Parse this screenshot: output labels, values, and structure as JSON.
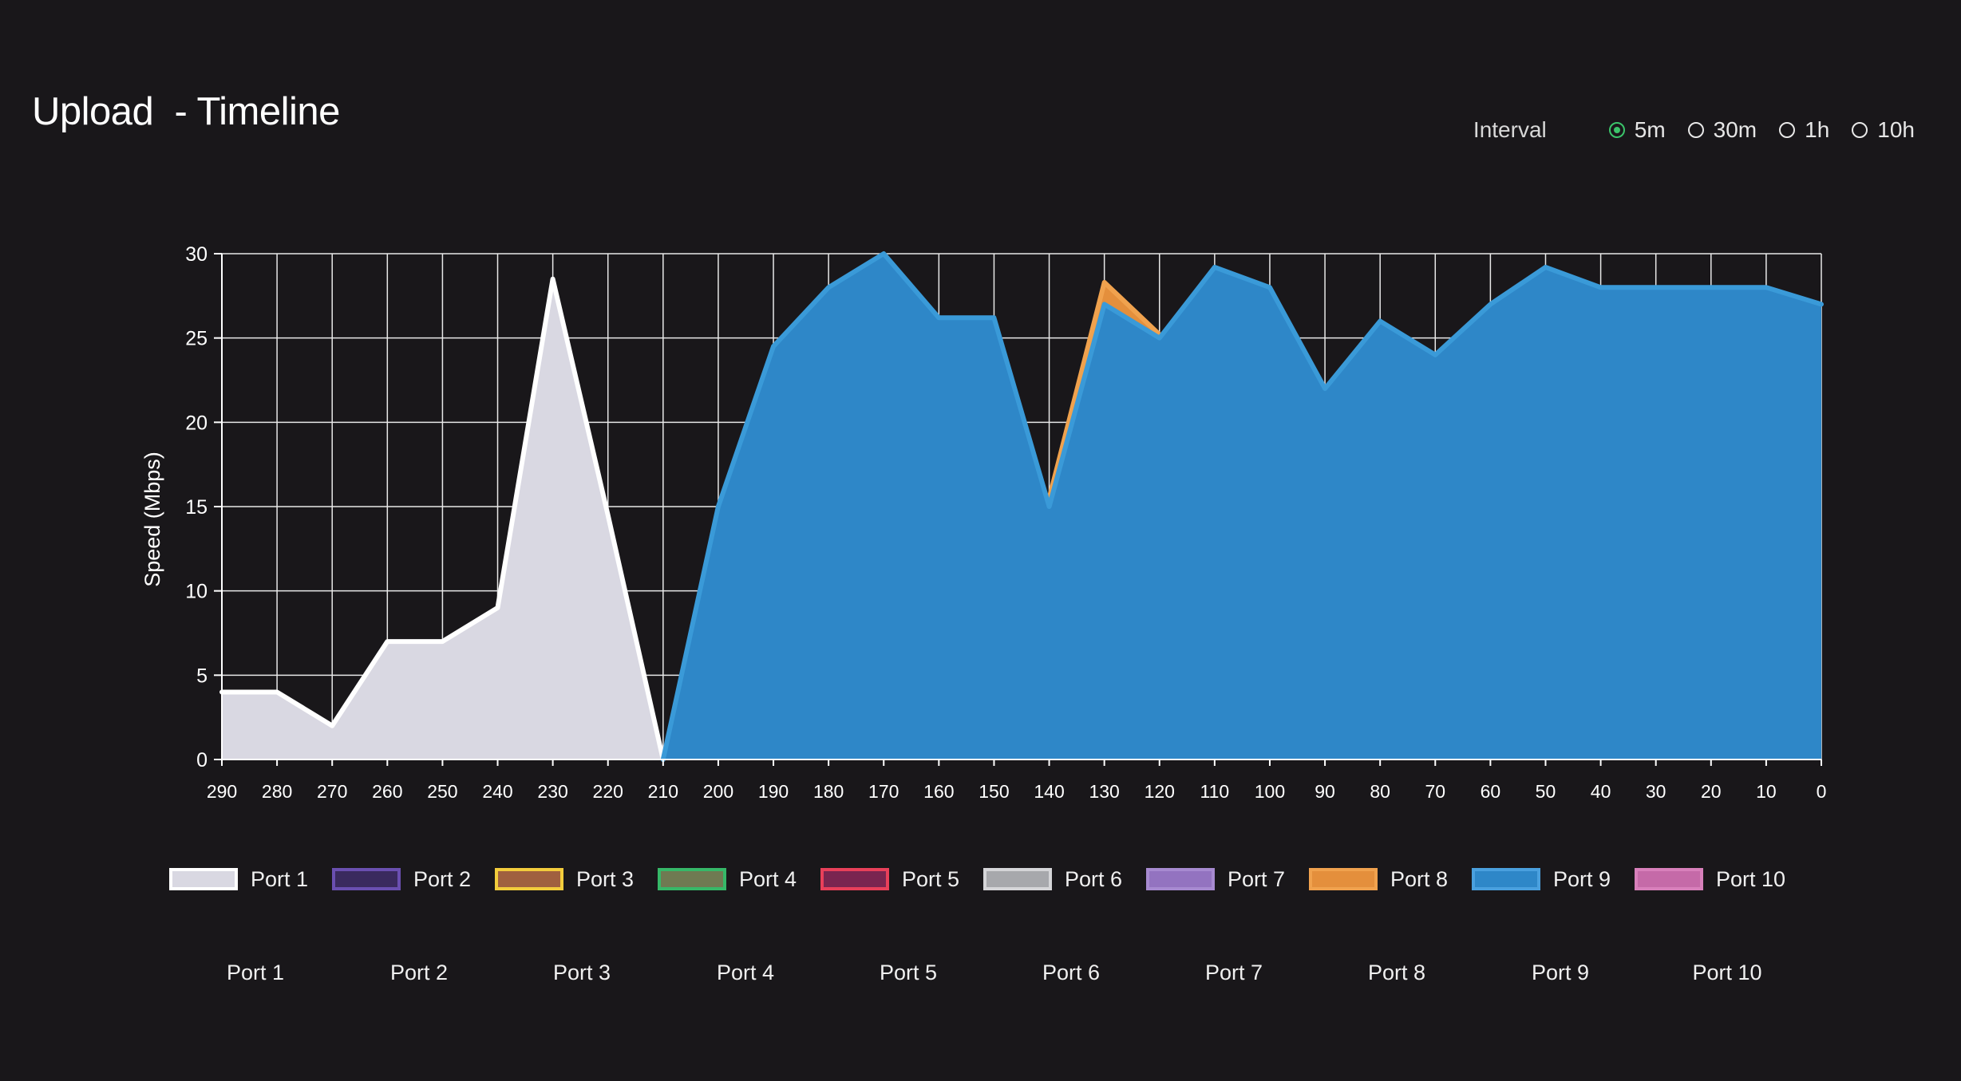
{
  "header": {
    "title": "Upload  - Timeline"
  },
  "interval": {
    "label": "Interval",
    "options": [
      {
        "label": "5m",
        "checked": true
      },
      {
        "label": "30m",
        "checked": false
      },
      {
        "label": "1h",
        "checked": false
      },
      {
        "label": "10h",
        "checked": false
      }
    ]
  },
  "chart_data": {
    "type": "area",
    "ylabel": "Speed (Mbps)",
    "xlabel": "",
    "ylim": [
      0,
      30
    ],
    "yticks": [
      0,
      5,
      10,
      15,
      20,
      25,
      30
    ],
    "xlim": [
      290,
      0
    ],
    "x_reversed": true,
    "grid": true,
    "x": [
      290,
      280,
      270,
      260,
      250,
      240,
      230,
      220,
      210,
      200,
      190,
      180,
      170,
      160,
      150,
      140,
      130,
      120,
      110,
      100,
      90,
      80,
      70,
      60,
      50,
      40,
      30,
      20,
      10,
      0
    ],
    "series": [
      {
        "name": "Port 1",
        "fill": "#d9d8e2",
        "stroke": "#ffffff",
        "values": [
          4,
          4,
          2,
          7,
          7,
          9,
          28.5,
          14.5,
          0,
          null,
          null,
          null,
          null,
          null,
          null,
          null,
          null,
          null,
          null,
          null,
          null,
          null,
          null,
          null,
          null,
          null,
          null,
          null,
          null,
          null
        ]
      },
      {
        "name": "Port 8",
        "fill": "#e48f3c",
        "stroke": "#f0a24e",
        "values": [
          null,
          null,
          null,
          null,
          null,
          null,
          null,
          null,
          null,
          null,
          null,
          null,
          null,
          null,
          null,
          15.5,
          28.3,
          25.2,
          null,
          null,
          null,
          null,
          null,
          null,
          null,
          null,
          null,
          null,
          null,
          null
        ]
      },
      {
        "name": "Port 9",
        "fill": "#2e87c8",
        "stroke": "#3a9ad8",
        "values": [
          null,
          null,
          null,
          null,
          null,
          null,
          null,
          null,
          0,
          15,
          24.5,
          28,
          30,
          26.2,
          26.2,
          15,
          27,
          25,
          29.2,
          28,
          22,
          26,
          24,
          27,
          29.2,
          28,
          28,
          28,
          28,
          27
        ]
      }
    ],
    "legend_placement": "bottom",
    "legend": [
      {
        "name": "Port 1",
        "fill": "#d9d8e2",
        "border": "#ffffff"
      },
      {
        "name": "Port 2",
        "fill": "#3a2a5e",
        "border": "#6a4fb0"
      },
      {
        "name": "Port 3",
        "fill": "#a0603f",
        "border": "#f2cc3c"
      },
      {
        "name": "Port 4",
        "fill": "#6f7a52",
        "border": "#36b868"
      },
      {
        "name": "Port 5",
        "fill": "#7a2550",
        "border": "#e8405a"
      },
      {
        "name": "Port 6",
        "fill": "#a7a8ac",
        "border": "#d5d5d8"
      },
      {
        "name": "Port 7",
        "fill": "#9373c0",
        "border": "#a78ad0"
      },
      {
        "name": "Port 8",
        "fill": "#e48f3c",
        "border": "#f0a24e"
      },
      {
        "name": "Port 9",
        "fill": "#2e87c8",
        "border": "#4aa0de"
      },
      {
        "name": "Port 10",
        "fill": "#c56aa8",
        "border": "#d880bb"
      }
    ],
    "bottom_labels": [
      "Port 1",
      "Port 2",
      "Port 3",
      "Port 4",
      "Port 5",
      "Port 6",
      "Port 7",
      "Port 8",
      "Port 9",
      "Port 10"
    ]
  }
}
